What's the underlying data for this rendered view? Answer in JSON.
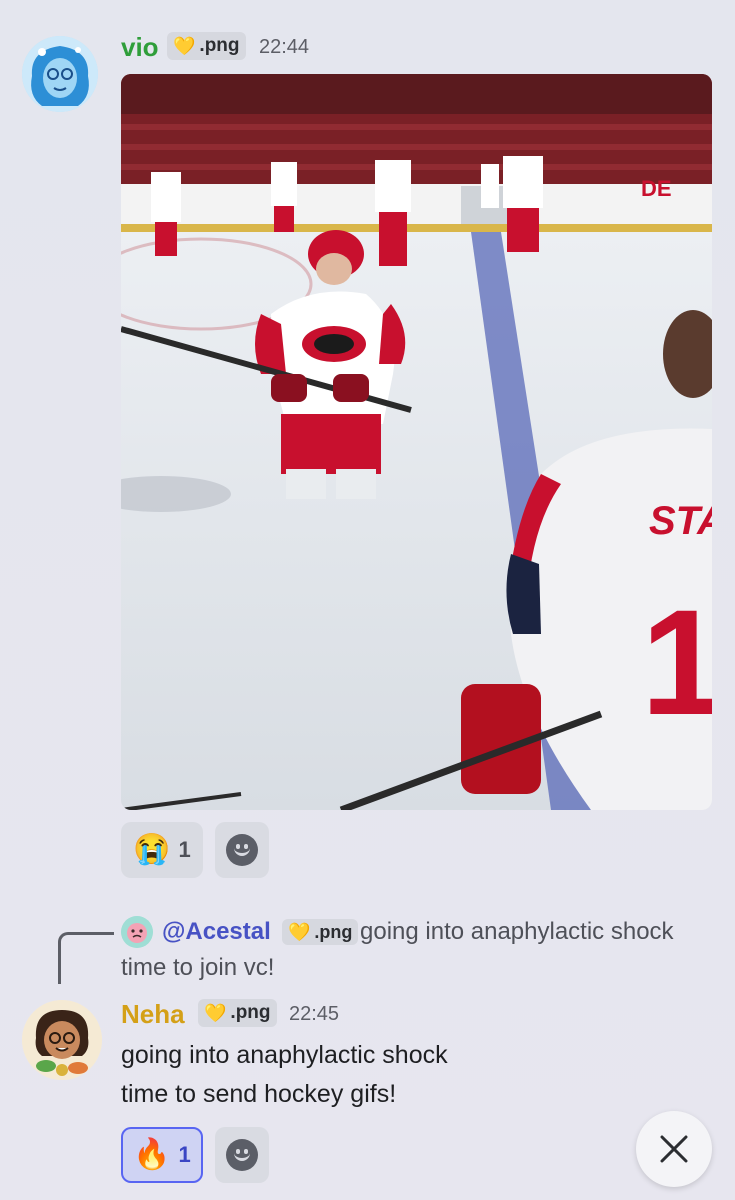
{
  "message1": {
    "username": "vio",
    "tag_label": ".png",
    "time": "22:44",
    "media_jersey_text": "STA",
    "media_number": "1",
    "reactions": [
      {
        "emoji": "😭",
        "count": "1"
      }
    ]
  },
  "reply": {
    "mention": "@Acestal",
    "tag_label": ".png",
    "preview_line1": "going into anaphylactic shock",
    "preview_line2": "time to join vc!"
  },
  "message2": {
    "username": "Neha",
    "tag_label": ".png",
    "time": "22:45",
    "text_line1": "going into anaphylactic shock",
    "text_line2": "time to send hockey gifs!",
    "reactions": [
      {
        "emoji": "🔥",
        "count": "1"
      }
    ]
  },
  "colors": {
    "vio_name": "#2f9e3a",
    "neha_name": "#d4a017",
    "mention": "#4752c4",
    "active_reaction_border": "#5865f2"
  },
  "icons": {
    "add_reaction": "smiley-icon",
    "close": "close-icon",
    "tag_heart": "heart-icon"
  }
}
